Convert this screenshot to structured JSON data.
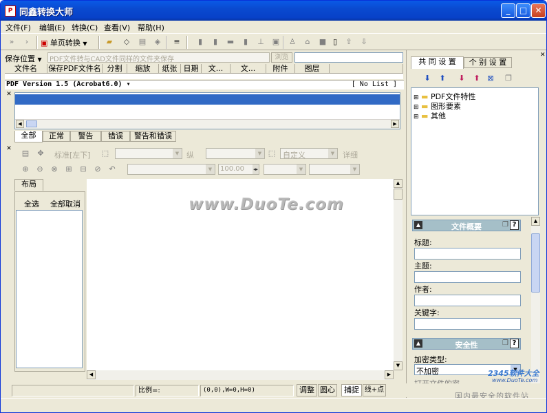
{
  "app": {
    "title": "同鑫转换大师"
  },
  "menu": [
    "文件(F)",
    "编辑(E)",
    "转换(C)",
    "查看(V)",
    "帮助(H)"
  ],
  "toolbar": {
    "single_page": "单页转换"
  },
  "save": {
    "location_label": "保存位置",
    "path_placeholder": "PDF文件转与CAD文件同样的文件夹保存",
    "browse": "浏览"
  },
  "file_table": {
    "columns": [
      "文件名",
      "保存PDF文件名",
      "分割",
      "缩放",
      "纸张",
      "日期",
      "文...",
      "文...",
      "附件",
      "图层"
    ]
  },
  "pdf_info": {
    "version": "PDF Version 1.5 (Acrobat6.0)",
    "list": "[ No List ]"
  },
  "msg_tabs": [
    "全部",
    "正常",
    "警告",
    "错误",
    "警告和错误"
  ],
  "view_toolbar": {
    "standard": "标准[左下]",
    "vertical": "纵",
    "custom": "自定义",
    "detail": "详细",
    "zoom_value": "100.00"
  },
  "layout_panel": {
    "tab": "布局",
    "select_all": "全选",
    "deselect_all": "全部取消"
  },
  "status": {
    "scale": "比例=:",
    "coords": "(0,0),W=0,H=0)",
    "adjust": "调整",
    "center": "圆心",
    "snap": "捕捉",
    "line_point": "线+点"
  },
  "settings": {
    "tabs": [
      "共 同 设 置",
      "个 别 设 置"
    ],
    "tree": [
      "PDF文件特性",
      "图形要素",
      "其他"
    ],
    "summary": {
      "header": "文件概要",
      "fields": [
        "标题:",
        "主题:",
        "作者:",
        "关键字:"
      ]
    },
    "security": {
      "header": "安全性",
      "encrypt_label": "加密类型:",
      "encrypt_value": "不加密",
      "open_pwd": "打开文件的密"
    }
  },
  "watermark": "www.DuoTe.com",
  "badge": {
    "brand": "2345软件大全",
    "url": "www.DuoTe.com",
    "tagline": "国内最安全的软件站"
  }
}
